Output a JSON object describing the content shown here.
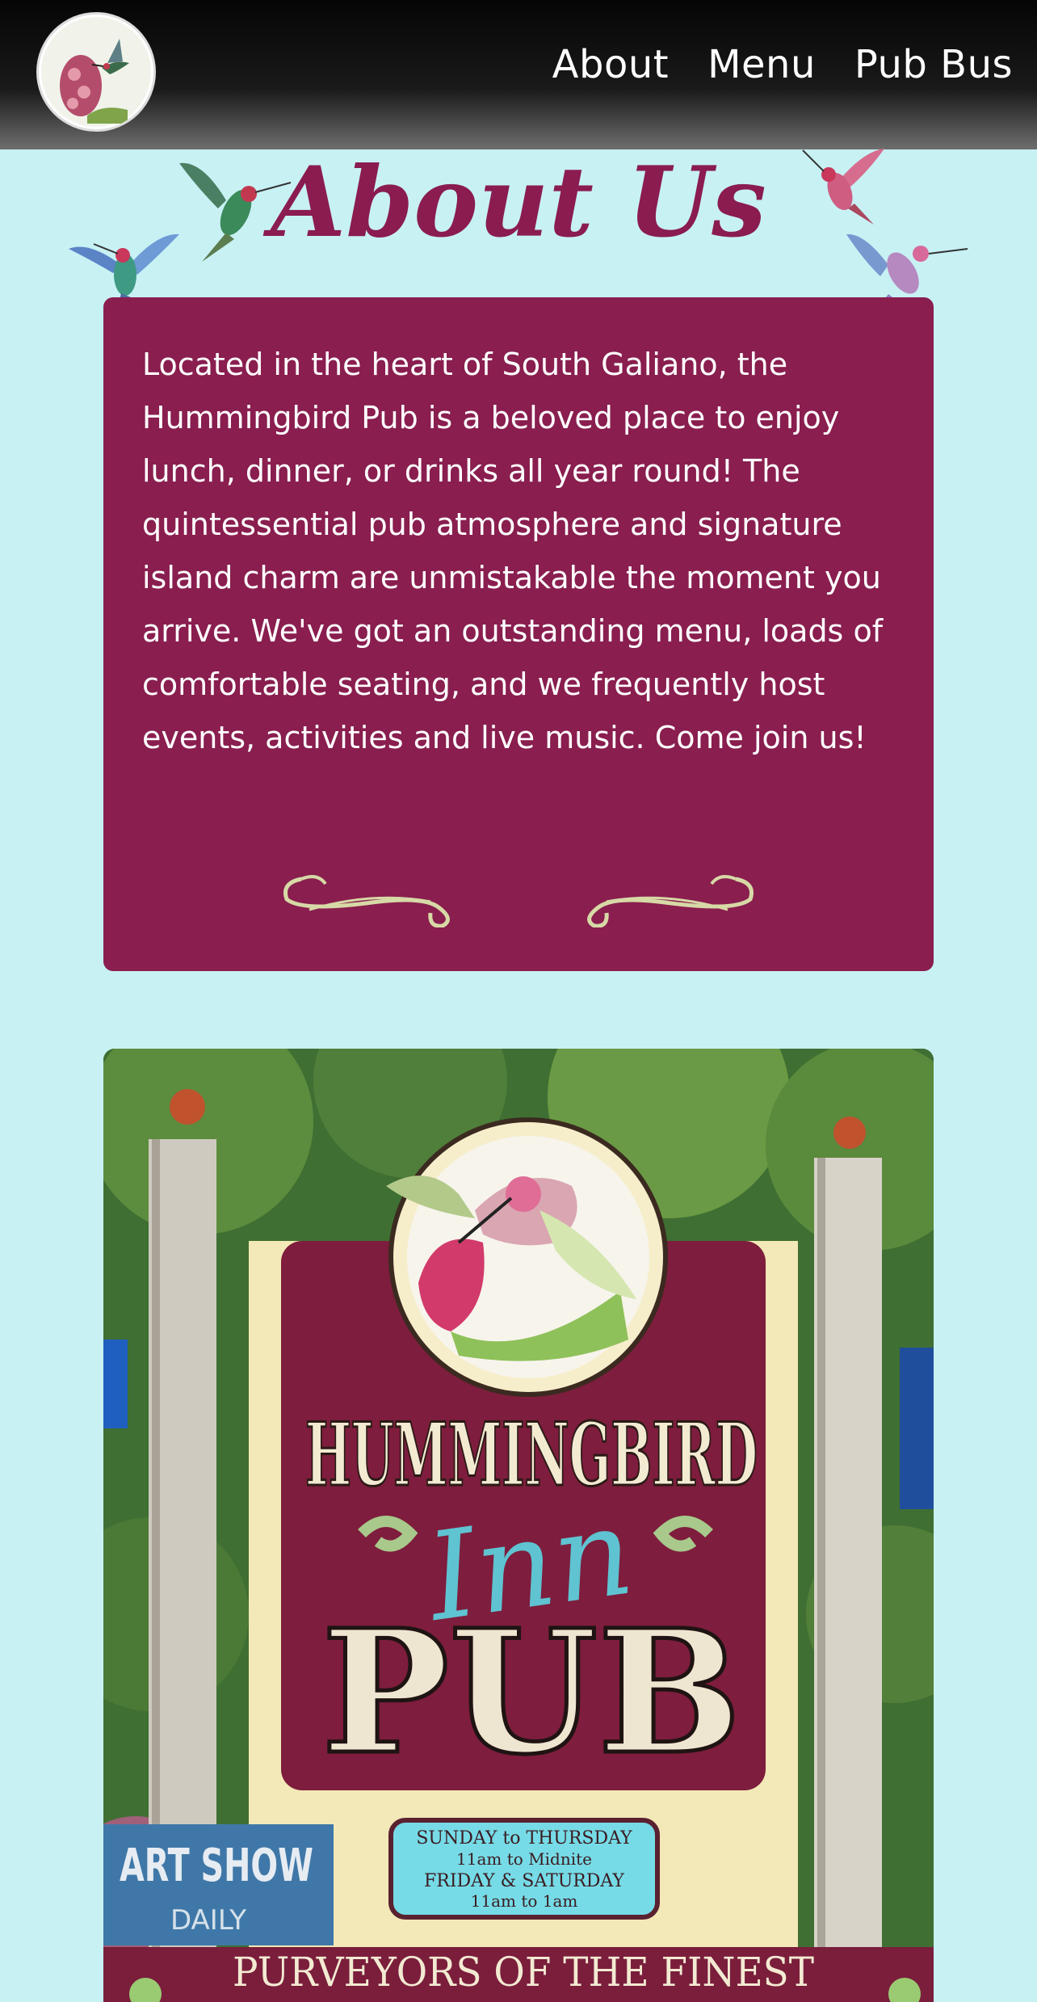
{
  "header": {
    "logo_icon": "hummingbird-logo-icon",
    "nav": [
      {
        "label": "About"
      },
      {
        "label": "Menu"
      },
      {
        "label": "Pub Bus"
      }
    ]
  },
  "about": {
    "title": "About Us",
    "paragraph": "Located in the heart of South Galiano, the Hummingbird Pub is a beloved place to enjoy lunch, dinner, or drinks all year round! The quintessential pub atmosphere and signature island charm are unmistakable the moment you arrive. We've got an outstanding menu, loads of comfortable seating, and we frequently host events, activities and live music. Come join us!"
  },
  "sign": {
    "line1": "HUMMINGBIRD",
    "line2": "Inn",
    "line3": "PUB",
    "hours": [
      "SUNDAY to THURSDAY",
      "11am to Midnite",
      "FRIDAY & SATURDAY",
      "11am to 1am"
    ],
    "art_show": "ART SHOW",
    "art_daily": "DAILY",
    "bottom_banner": "PURVEYORS OF THE FINEST"
  },
  "colors": {
    "background": "#c8f1f4",
    "accent": "#891e4f",
    "title": "#8a1c50",
    "flourish": "#d7d9a6"
  }
}
